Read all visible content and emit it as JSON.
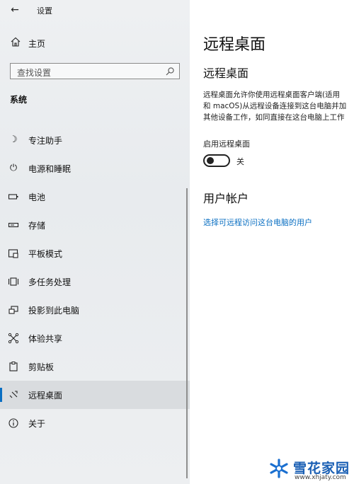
{
  "window": {
    "title": "设置",
    "back_icon": "back-arrow-icon"
  },
  "sidebar": {
    "home_label": "主页",
    "search_placeholder": "查找设置",
    "section_title": "系统",
    "items": [
      {
        "label": "专注助手",
        "icon": "moon-icon"
      },
      {
        "label": "电源和睡眠",
        "icon": "power-icon"
      },
      {
        "label": "电池",
        "icon": "battery-icon"
      },
      {
        "label": "存储",
        "icon": "storage-icon"
      },
      {
        "label": "平板模式",
        "icon": "tablet-mode-icon"
      },
      {
        "label": "多任务处理",
        "icon": "multitasking-icon"
      },
      {
        "label": "投影到此电脑",
        "icon": "project-icon"
      },
      {
        "label": "体验共享",
        "icon": "shared-experiences-icon"
      },
      {
        "label": "剪贴板",
        "icon": "clipboard-icon"
      },
      {
        "label": "远程桌面",
        "icon": "remote-desktop-icon",
        "active": true
      },
      {
        "label": "关于",
        "icon": "info-icon"
      }
    ]
  },
  "main": {
    "page_title": "远程桌面",
    "section_title": "远程桌面",
    "description_lines": [
      "远程桌面允许你使用远程桌面客户端(适用",
      "和 macOS)从远程设备连接到这台电脑并加",
      "其他设备工作，如同直接在这台电脑上工作"
    ],
    "toggle_label": "启用远程桌面",
    "toggle_state": "关",
    "toggle_on": false,
    "accounts_title": "用户帐户",
    "accounts_link": "选择可远程访问这台电脑的用户"
  },
  "watermark": {
    "text": "雪花家园",
    "url": "www.xhjaty.com"
  },
  "colors": {
    "accent": "#0a6fc2",
    "sidebar_bg": "#eceef0",
    "active_bg": "#d9dcdf"
  }
}
